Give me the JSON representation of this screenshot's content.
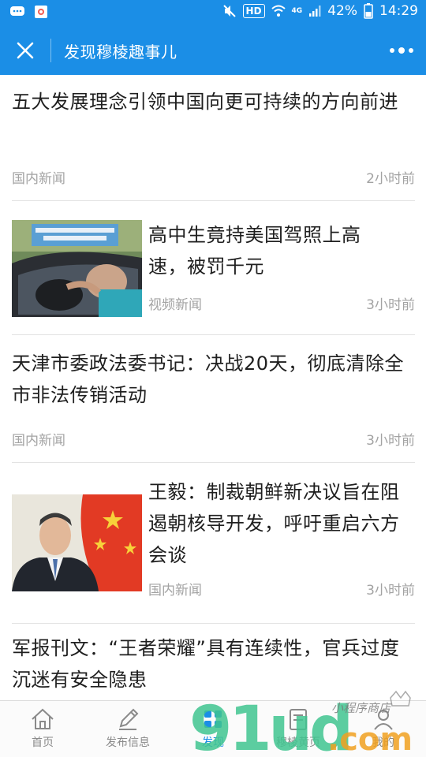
{
  "status_bar": {
    "hd": "HD",
    "network": "4G",
    "battery": "42%",
    "time": "14:29"
  },
  "title_bar": {
    "title": "发现穆棱趣事儿"
  },
  "news": [
    {
      "title": "五大发展理念引领中国向更可持续的方向前进",
      "category": "国内新闻",
      "time": "2小时前",
      "has_image": false
    },
    {
      "title": "高中生竟持美国驾照上高速，被罚千元",
      "category": "视频新闻",
      "time": "3小时前",
      "has_image": true,
      "image_icon": "car-driver-photo"
    },
    {
      "title": "天津市委政法委书记：决战20天，彻底清除全市非法传销活动",
      "category": "国内新闻",
      "time": "3小时前",
      "has_image": false
    },
    {
      "title": "王毅：制裁朝鲜新决议旨在阻遏朝核导开发，呼吁重启六方会谈",
      "category": "国内新闻",
      "time": "3小时前",
      "has_image": true,
      "image_icon": "official-with-flag-photo"
    },
    {
      "title": "军报刊文：“王者荣耀”具有连续性，官兵过度沉迷有安全隐患",
      "category": "",
      "time": "",
      "has_image": false
    }
  ],
  "tabs": [
    {
      "label": "首页",
      "icon": "home-icon",
      "active": false
    },
    {
      "label": "发布信息",
      "icon": "pencil-icon",
      "active": false
    },
    {
      "label": "发现",
      "icon": "discover-icon",
      "active": true
    },
    {
      "label": "穆棱黄页",
      "icon": "yellow-pages-icon",
      "active": false
    },
    {
      "label": "我的",
      "icon": "user-icon",
      "active": false
    }
  ],
  "colors": {
    "brand": "#1b8ee6",
    "meta_text": "#a3a3a3",
    "watermark_green": "#3fc48f",
    "watermark_orange": "#f0a020"
  },
  "watermark": {
    "logo_text": "91ud.com",
    "script_text": "小程序商店"
  }
}
